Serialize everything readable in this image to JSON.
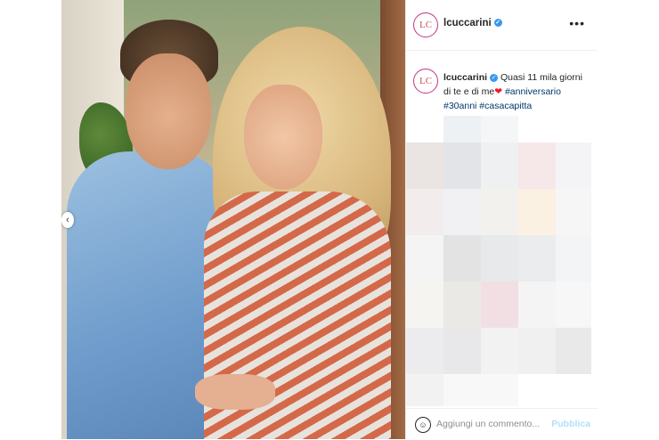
{
  "post": {
    "username": "lcuccarini",
    "avatar_text": "LC",
    "more_label": "•••",
    "caption": {
      "text_part1": "Quasi 11 mila giorni di te e di me",
      "heart": "❤",
      "hashtags": [
        "#anniversario",
        "#30anni",
        "#casacapitta"
      ]
    },
    "comment_placeholder": "Aggiungi un commento...",
    "publish_label": "Pubblica",
    "carousel_arrow": "‹"
  },
  "colors": {
    "verified": "#3897f0",
    "hashtag": "#00376b",
    "publish": "#b2dffc",
    "avatar_ring": "#c13584"
  }
}
